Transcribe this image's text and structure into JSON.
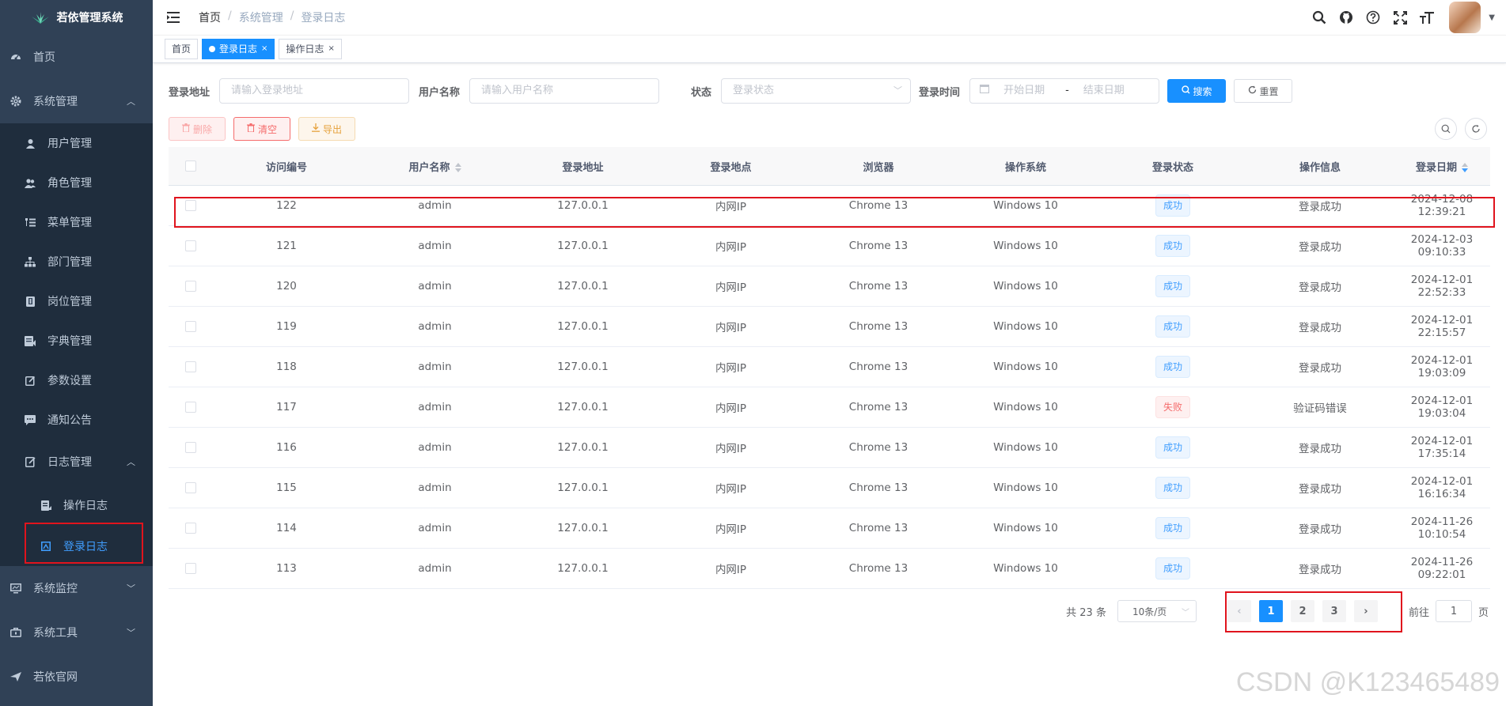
{
  "app": {
    "title": "若依管理系统"
  },
  "sidebar": {
    "items": [
      {
        "label": "首页"
      },
      {
        "label": "系统管理"
      },
      {
        "label": "用户管理"
      },
      {
        "label": "角色管理"
      },
      {
        "label": "菜单管理"
      },
      {
        "label": "部门管理"
      },
      {
        "label": "岗位管理"
      },
      {
        "label": "字典管理"
      },
      {
        "label": "参数设置"
      },
      {
        "label": "通知公告"
      },
      {
        "label": "日志管理"
      },
      {
        "label": "操作日志"
      },
      {
        "label": "登录日志"
      },
      {
        "label": "系统监控"
      },
      {
        "label": "系统工具"
      },
      {
        "label": "若依官网"
      }
    ]
  },
  "breadcrumb": {
    "home": "首页",
    "section": "系统管理",
    "current": "登录日志"
  },
  "tags": {
    "home": "首页",
    "login_log": "登录日志",
    "oper_log": "操作日志"
  },
  "search": {
    "addr_label": "登录地址",
    "addr_placeholder": "请输入登录地址",
    "user_label": "用户名称",
    "user_placeholder": "请输入用户名称",
    "status_label": "状态",
    "status_placeholder": "登录状态",
    "time_label": "登录时间",
    "start_placeholder": "开始日期",
    "range_sep": "-",
    "end_placeholder": "结束日期",
    "search_btn": "搜索",
    "reset_btn": "重置"
  },
  "toolbar": {
    "delete": "删除",
    "clear": "清空",
    "export": "导出"
  },
  "table": {
    "columns": [
      "访问编号",
      "用户名称",
      "登录地址",
      "登录地点",
      "浏览器",
      "操作系统",
      "登录状态",
      "操作信息",
      "登录日期"
    ],
    "rows": [
      {
        "id": "122",
        "user": "admin",
        "ip": "127.0.0.1",
        "loc": "内网IP",
        "browser": "Chrome 13",
        "os": "Windows 10",
        "status": "成功",
        "msg": "登录成功",
        "date": "2024-12-08 12:39:21"
      },
      {
        "id": "121",
        "user": "admin",
        "ip": "127.0.0.1",
        "loc": "内网IP",
        "browser": "Chrome 13",
        "os": "Windows 10",
        "status": "成功",
        "msg": "登录成功",
        "date": "2024-12-03 09:10:33"
      },
      {
        "id": "120",
        "user": "admin",
        "ip": "127.0.0.1",
        "loc": "内网IP",
        "browser": "Chrome 13",
        "os": "Windows 10",
        "status": "成功",
        "msg": "登录成功",
        "date": "2024-12-01 22:52:33"
      },
      {
        "id": "119",
        "user": "admin",
        "ip": "127.0.0.1",
        "loc": "内网IP",
        "browser": "Chrome 13",
        "os": "Windows 10",
        "status": "成功",
        "msg": "登录成功",
        "date": "2024-12-01 22:15:57"
      },
      {
        "id": "118",
        "user": "admin",
        "ip": "127.0.0.1",
        "loc": "内网IP",
        "browser": "Chrome 13",
        "os": "Windows 10",
        "status": "成功",
        "msg": "登录成功",
        "date": "2024-12-01 19:03:09"
      },
      {
        "id": "117",
        "user": "admin",
        "ip": "127.0.0.1",
        "loc": "内网IP",
        "browser": "Chrome 13",
        "os": "Windows 10",
        "status": "失败",
        "msg": "验证码错误",
        "date": "2024-12-01 19:03:04"
      },
      {
        "id": "116",
        "user": "admin",
        "ip": "127.0.0.1",
        "loc": "内网IP",
        "browser": "Chrome 13",
        "os": "Windows 10",
        "status": "成功",
        "msg": "登录成功",
        "date": "2024-12-01 17:35:14"
      },
      {
        "id": "115",
        "user": "admin",
        "ip": "127.0.0.1",
        "loc": "内网IP",
        "browser": "Chrome 13",
        "os": "Windows 10",
        "status": "成功",
        "msg": "登录成功",
        "date": "2024-12-01 16:16:34"
      },
      {
        "id": "114",
        "user": "admin",
        "ip": "127.0.0.1",
        "loc": "内网IP",
        "browser": "Chrome 13",
        "os": "Windows 10",
        "status": "成功",
        "msg": "登录成功",
        "date": "2024-11-26 10:10:54"
      },
      {
        "id": "113",
        "user": "admin",
        "ip": "127.0.0.1",
        "loc": "内网IP",
        "browser": "Chrome 13",
        "os": "Windows 10",
        "status": "成功",
        "msg": "登录成功",
        "date": "2024-11-26 09:22:01"
      }
    ]
  },
  "pagination": {
    "total": "共 23 条",
    "page_size": "10条/页",
    "pages": [
      "1",
      "2",
      "3"
    ],
    "current": "1",
    "goto_prefix": "前往",
    "goto_value": "1",
    "goto_suffix": "页"
  },
  "watermark": "CSDN @K123465489",
  "colors": {
    "sidebar_bg": "#304156",
    "primary": "#1890ff",
    "danger": "#f56c6c",
    "warning": "#e6a23c",
    "highlight": "#e0141d"
  },
  "icons": [
    "dashboard-icon",
    "gear-icon",
    "user-icon",
    "peoples-icon",
    "tree-table-icon",
    "tree-icon",
    "post-icon",
    "dict-icon",
    "edit-icon",
    "message-icon",
    "log-icon",
    "form-icon",
    "logininfor-icon",
    "monitor-icon",
    "tool-icon",
    "guide-icon",
    "search-icon",
    "github-icon",
    "question-icon",
    "fullscreen-icon",
    "size-icon",
    "calendar-icon",
    "refresh-icon",
    "trash-icon",
    "download-icon"
  ]
}
